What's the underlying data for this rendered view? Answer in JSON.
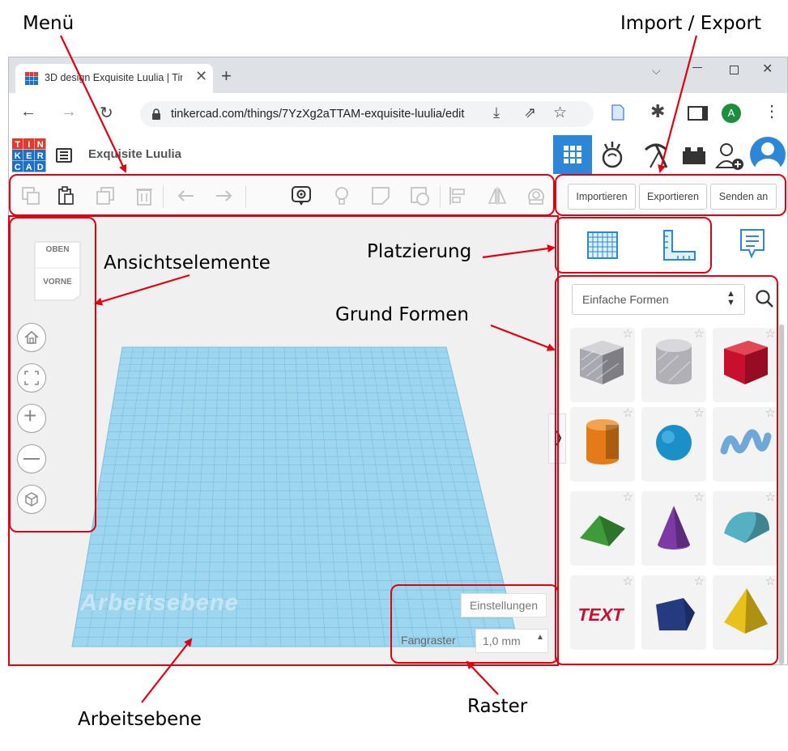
{
  "annotations": {
    "menu": "Menü",
    "import_export": "Import / Export",
    "view_elements": "Ansichtselemente",
    "placement": "Platzierung",
    "basic_shapes": "Grund Formen",
    "workplane": "Arbeitsebene",
    "grid": "Raster"
  },
  "browser": {
    "tab_title": "3D design Exquisite Luulia | Tin",
    "new_tab": "+",
    "url": "tinkercad.com/things/7YzXg2aTTAM-exquisite-luulia/edit",
    "profile_initial": "A",
    "window_controls": [
      "chevron-down",
      "minimize",
      "maximize",
      "close"
    ]
  },
  "app": {
    "logo_letters": [
      "T",
      "I",
      "N",
      "K",
      "E",
      "R",
      "C",
      "A",
      "D"
    ],
    "design_name": "Exquisite Luulia",
    "top_icons": [
      "grid-view-icon",
      "sim-lab-icon",
      "pickaxe-icon",
      "bricks-icon",
      "add-user-icon",
      "avatar"
    ]
  },
  "toolbar": {
    "tools": [
      "copy-icon",
      "paste-icon",
      "duplicate-icon",
      "delete-icon",
      "undo-icon",
      "redo-icon",
      "notes-icon",
      "bulb-icon",
      "shape-icon",
      "hole-icon",
      "align-icon",
      "mirror-icon",
      "group-icon"
    ],
    "import_label": "Importieren",
    "export_label": "Exportieren",
    "send_label": "Senden an"
  },
  "viewcube": {
    "top": "OBEN",
    "front": "VORNE"
  },
  "nav_buttons": [
    "home-icon",
    "fit-icon",
    "zoom-in-icon",
    "zoom-out-icon",
    "perspective-icon"
  ],
  "workplane": {
    "watermark": "Arbeitsebene",
    "settings_label": "Einstellungen",
    "snap_label": "Fangraster",
    "snap_value": "1,0 mm"
  },
  "sidepanel": {
    "category": "Einfache Formen",
    "shapes": [
      {
        "name": "box-striped",
        "color": "#a8a8b0"
      },
      {
        "name": "cylinder-striped",
        "color": "#b0b0b6"
      },
      {
        "name": "box",
        "color": "#c8102e"
      },
      {
        "name": "cylinder",
        "color": "#e57b17"
      },
      {
        "name": "sphere",
        "color": "#1b8fc7"
      },
      {
        "name": "scribble",
        "color": "#6fa8d6"
      },
      {
        "name": "roof",
        "color": "#3d9b3a"
      },
      {
        "name": "cone",
        "color": "#7d3aa6"
      },
      {
        "name": "round-roof",
        "color": "#55b1c2"
      },
      {
        "name": "text",
        "color": "#c8102e"
      },
      {
        "name": "polygon",
        "color": "#263a82"
      },
      {
        "name": "pyramid",
        "color": "#e8c21a"
      }
    ]
  },
  "colors": {
    "annotation_red": "#e3000f",
    "workplane_blue": "#9fd6ef",
    "accent_blue": "#2d87d6"
  }
}
